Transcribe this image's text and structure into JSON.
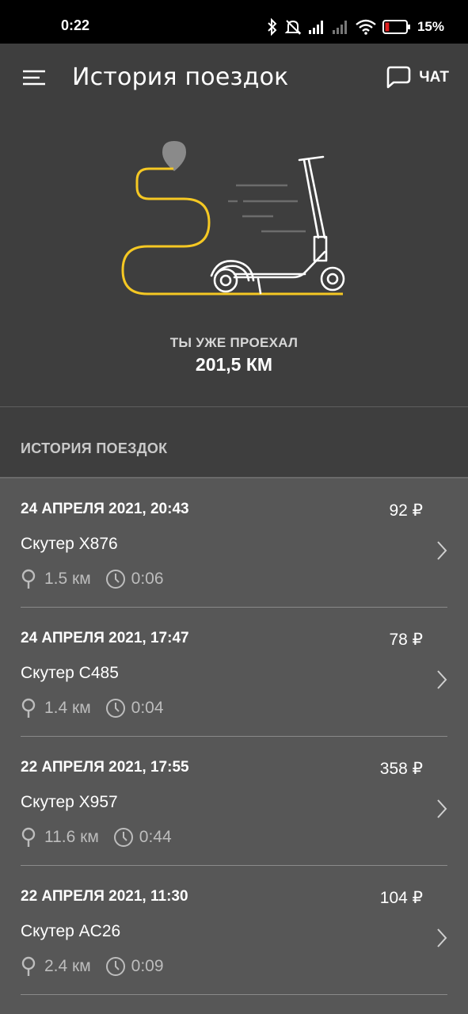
{
  "status_bar": {
    "time": "0:22",
    "battery_percent": "15%",
    "battery_level": 0.15
  },
  "header": {
    "title": "История поездок",
    "chat_label": "ЧАТ"
  },
  "summary": {
    "label": "ТЫ УЖЕ ПРОЕХАЛ",
    "distance": "201,5 КМ"
  },
  "history": {
    "section_title": "ИСТОРИЯ ПОЕЗДОК",
    "trips": [
      {
        "date": "24 АПРЕЛЯ 2021, 20:43",
        "price": "92 ₽",
        "scooter": "Скутер X876",
        "distance": "1.5 км",
        "duration": "0:06"
      },
      {
        "date": "24 АПРЕЛЯ 2021, 17:47",
        "price": "78 ₽",
        "scooter": "Скутер C485",
        "distance": "1.4 км",
        "duration": "0:04"
      },
      {
        "date": "22 АПРЕЛЯ 2021, 17:55",
        "price": "358 ₽",
        "scooter": "Скутер X957",
        "distance": "11.6 км",
        "duration": "0:44"
      },
      {
        "date": "22 АПРЕЛЯ 2021, 11:30",
        "price": "104 ₽",
        "scooter": "Скутер AC26",
        "distance": "2.4 км",
        "duration": "0:09"
      }
    ]
  },
  "colors": {
    "accent_yellow": "#f5c823",
    "header_bg": "#3e3e3e",
    "list_bg": "#575757"
  }
}
